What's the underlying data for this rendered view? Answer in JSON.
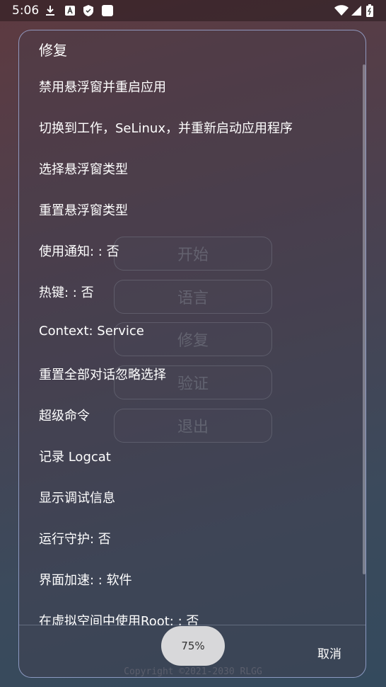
{
  "status_bar": {
    "time": "5:06",
    "left_icons": [
      "download-icon",
      "a-box-icon",
      "shield-icon",
      "square-icon"
    ],
    "right_icons": [
      "wifi-icon",
      "signal-icon",
      "battery-icon"
    ]
  },
  "background_buttons": [
    {
      "label": "开始"
    },
    {
      "label": "语言"
    },
    {
      "label": "修复"
    },
    {
      "label": "验证"
    },
    {
      "label": "退出"
    }
  ],
  "copyright": "Copyright ©2021-2030 RLGG",
  "dialog": {
    "title": "修复",
    "items": [
      {
        "label": "禁用悬浮窗并重启应用"
      },
      {
        "label": "切换到工作，SeLinux，并重新启动应用程序"
      },
      {
        "label": "选择悬浮窗类型"
      },
      {
        "label": "重置悬浮窗类型"
      },
      {
        "label": "使用通知: : 否"
      },
      {
        "label": "热键: : 否"
      },
      {
        "label": "Context: Service"
      },
      {
        "label": "重置全部对话忽略选择"
      },
      {
        "label": "超级命令"
      },
      {
        "label": "记录 Logcat"
      },
      {
        "label": "显示调试信息"
      },
      {
        "label": "运行守护: 否"
      },
      {
        "label": "界面加速: : 软件"
      },
      {
        "label": "在虚拟空间中使用Root: : 否"
      }
    ],
    "zoom_label": "75%",
    "cancel_label": "取消"
  },
  "colors": {
    "dialog_border": "#a0afdc",
    "text": "#ffffff",
    "pill_bg": "#d8d8da"
  }
}
